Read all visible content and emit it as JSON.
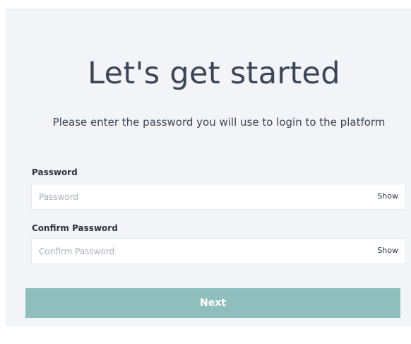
{
  "header": {
    "title": "Let's get started",
    "subtitle": "Please enter the password you will use to login to the platform"
  },
  "form": {
    "password": {
      "label": "Password",
      "placeholder": "Password",
      "value": "",
      "toggle_label": "Show"
    },
    "confirm_password": {
      "label": "Confirm Password",
      "placeholder": "Confirm Password",
      "value": "",
      "toggle_label": "Show"
    },
    "submit_label": "Next"
  },
  "colors": {
    "panel_background": "#f3f4f8",
    "text_primary": "#3a4556",
    "button_background": "#8fbfbd",
    "button_text": "#ffffff"
  }
}
